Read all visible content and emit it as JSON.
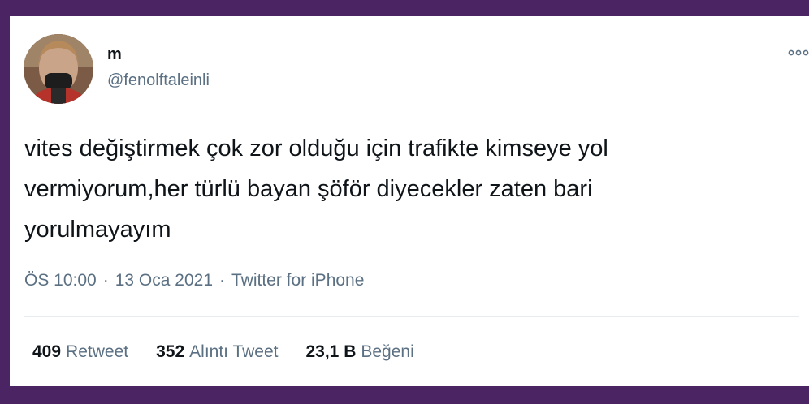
{
  "user": {
    "display_name": "m",
    "handle": "@fenolftaleinli"
  },
  "tweet": {
    "text_lines": [
      "vites değiştirmek çok zor olduğu için trafikte kimseye yol",
      "vermiyorum,her türlü bayan şöför diyecekler zaten bari",
      "yorulmayayım"
    ],
    "time": "ÖS 10:00",
    "date": "13 Oca 2021",
    "separator": "·",
    "source": "Twitter for iPhone"
  },
  "stats": [
    {
      "count": "409",
      "label": "Retweet"
    },
    {
      "count": "352",
      "label": "Alıntı Tweet"
    },
    {
      "count": "23,1 B",
      "label": "Beğeni"
    }
  ],
  "icons": {
    "more": "more-horizontal-icon",
    "avatar": "avatar-photo"
  },
  "colors": {
    "frame": "#4a2463",
    "text": "#0f1419",
    "secondary": "#5b7083",
    "divider": "#e6ecf0"
  }
}
